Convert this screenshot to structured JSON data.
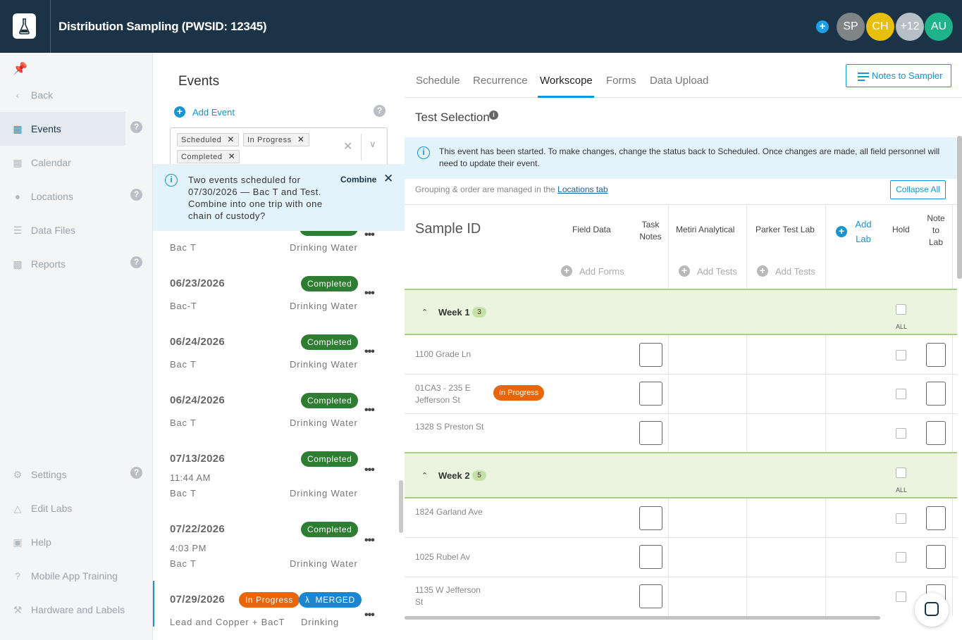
{
  "header": {
    "title": "Distribution Sampling (PWSID: 12345)",
    "avatars": [
      {
        "initials": "SP",
        "color": "#7f8487"
      },
      {
        "initials": "CH",
        "color": "#e8bf0c"
      },
      {
        "initials": "+12",
        "color": "#b6bec6"
      },
      {
        "initials": "AU",
        "color": "#1fb38a"
      }
    ]
  },
  "nav": {
    "back": "Back",
    "items": [
      {
        "label": "Events"
      },
      {
        "label": "Calendar"
      },
      {
        "label": "Locations"
      },
      {
        "label": "Data Files"
      },
      {
        "label": "Reports"
      }
    ],
    "bottom": [
      {
        "label": "Settings"
      },
      {
        "label": "Edit Labs"
      },
      {
        "label": "Help"
      },
      {
        "label": "Mobile App Training"
      },
      {
        "label": "Hardware and Labels"
      }
    ]
  },
  "events": {
    "title": "Events",
    "add_event": "Add Event",
    "filters": [
      "Scheduled",
      "In Progress",
      "Completed"
    ],
    "banner": {
      "text": "Two events scheduled for 07/30/2026 — Bac T and Test. Combine into one trip with one chain of custody?",
      "action": "Combine"
    },
    "list": [
      {
        "date": "",
        "time": "",
        "name": "Bac T",
        "type": "Drinking Water",
        "status": ""
      },
      {
        "date": "06/23/2026",
        "time": "",
        "name": "Bac-T",
        "type": "Drinking Water",
        "status": "Completed"
      },
      {
        "date": "06/24/2026",
        "time": "",
        "name": "Bac T",
        "type": "Drinking Water",
        "status": "Completed"
      },
      {
        "date": "06/24/2026",
        "time": "",
        "name": "Bac T",
        "type": "Drinking Water",
        "status": "Completed"
      },
      {
        "date": "07/13/2026",
        "time": "11:44 AM",
        "name": "Bac T",
        "type": "Drinking Water",
        "status": "Completed"
      },
      {
        "date": "07/22/2026",
        "time": "4:03 PM",
        "name": "Bac T",
        "type": "Drinking Water",
        "status": "Completed"
      },
      {
        "date": "07/29/2026",
        "time": "",
        "name": "Lead and Copper + BacT",
        "type": "Drinking",
        "status": "In Progress",
        "tag": "MERGED"
      }
    ]
  },
  "tabs": [
    "Schedule",
    "Recurrence",
    "Workscope",
    "Forms",
    "Data Upload"
  ],
  "notes_button": "Notes to Sampler",
  "test_selection": {
    "title": "Test Selection",
    "banner": "This event has been started. To make changes, change the status back to Scheduled. Once changes are made, all field personnel will need to update their event.",
    "grouping_text": "Grouping & order are managed in the",
    "grouping_link": "Locations tab",
    "collapse_all": "Collapse All"
  },
  "table": {
    "sample_id": "Sample ID",
    "field_data": "Field Data",
    "task_notes": "Task Notes",
    "labs": [
      "Metiri Analytical",
      "Parker Test Lab"
    ],
    "add_lab": "Add Lab",
    "hold": "Hold",
    "note_to_lab": "Note to Lab",
    "add_forms": "Add Forms",
    "add_tests": "Add Tests",
    "all_label": "ALL",
    "weeks": [
      {
        "label": "Week 1",
        "count": "3",
        "samples": [
          {
            "id": "1100 Grade Ln",
            "status": ""
          },
          {
            "id": "01CA3 - 235 E Jefferson St",
            "status": "In Progress"
          },
          {
            "id": "1328 S Preston St",
            "status": ""
          }
        ]
      },
      {
        "label": "Week 2",
        "count": "5",
        "samples": [
          {
            "id": "1824 Garland Ave",
            "status": ""
          },
          {
            "id": "1025 Rubel Av",
            "status": ""
          },
          {
            "id": "1135 W Jefferson St",
            "status": ""
          }
        ]
      }
    ]
  },
  "colors": {
    "primary": "#1595d3",
    "header": "#1b3347",
    "completed": "#2e7d32",
    "in_progress": "#e8650a",
    "merged": "#1b86cf",
    "week": "#eaf4df"
  }
}
